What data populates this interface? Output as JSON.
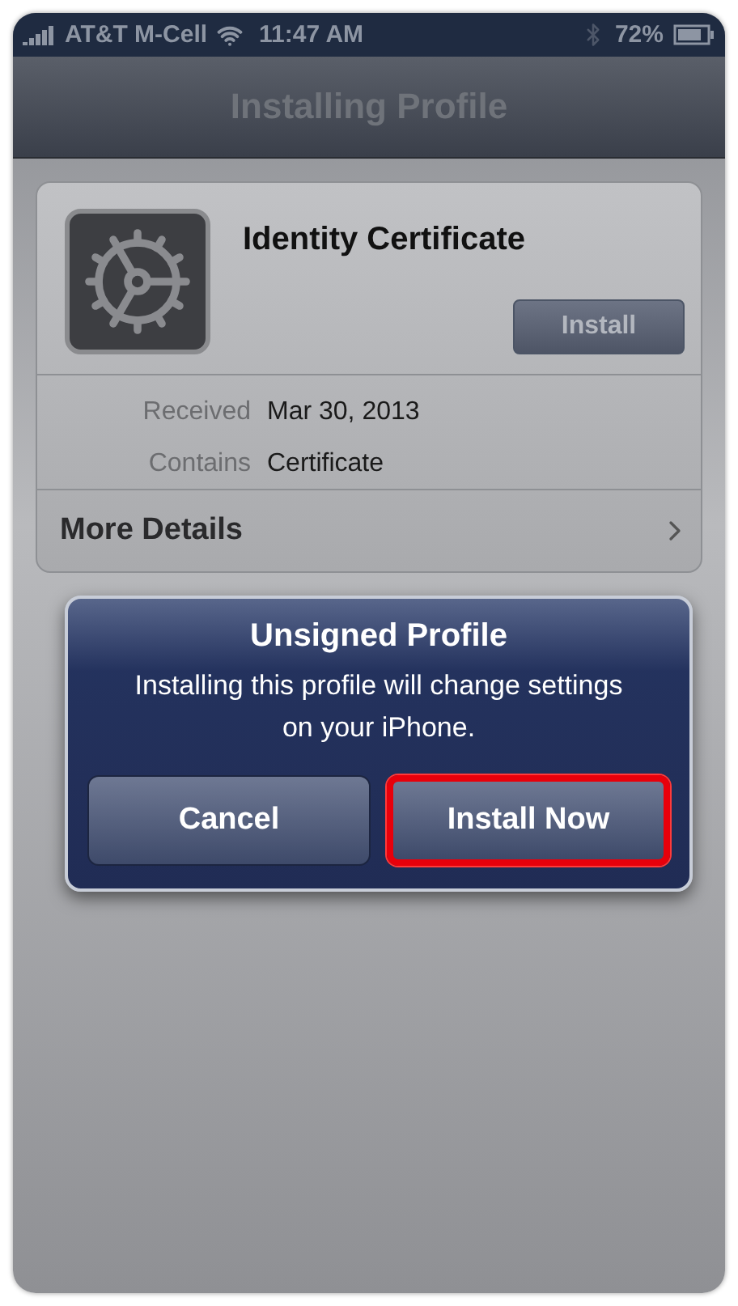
{
  "status_bar": {
    "carrier": "AT&T M-Cell",
    "time": "11:47 AM",
    "battery": "72%"
  },
  "nav_bar": {
    "title": "Installing Profile"
  },
  "profile": {
    "name": "Identity Certificate",
    "install_button": "Install",
    "details": [
      {
        "label": "Received",
        "value": "Mar 30, 2013"
      },
      {
        "label": "Contains",
        "value": "Certificate"
      }
    ],
    "more_link": "More Details"
  },
  "alert": {
    "title": "Unsigned Profile",
    "message": "Installing this profile will change settings on your iPhone.",
    "buttons": [
      {
        "label": "Cancel",
        "highlighted": false
      },
      {
        "label": "Install Now",
        "highlighted": true
      }
    ]
  }
}
